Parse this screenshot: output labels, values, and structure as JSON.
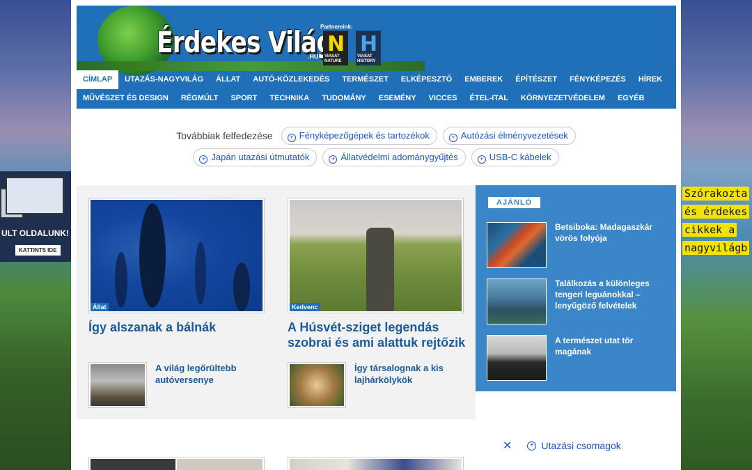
{
  "site": {
    "logo_text": "Érdekes Világ",
    "logo_suffix": ".HU",
    "partners_label": "Partnereink:",
    "partners": [
      {
        "letter": "N",
        "label": "VIASAT NATURE"
      },
      {
        "letter": "H",
        "label": "VIASAT HISTORY"
      }
    ]
  },
  "nav": {
    "row1": [
      "CÍMLAP",
      "UTAZÁS-NAGYVILÁG",
      "ÁLLAT",
      "AUTÓ-KÖZLEKEDÉS",
      "TERMÉSZET",
      "ELKÉPESZTŐ",
      "EMBEREK",
      "ÉPÍTÉSZET",
      "FÉNYKÉPEZÉS",
      "HÍREK"
    ],
    "row2": [
      "MŰVÉSZET ÉS DESIGN",
      "RÉGMÚLT",
      "SPORT",
      "TECHNIKA",
      "TUDOMÁNY",
      "ESEMÉNY",
      "VICCES",
      "ÉTEL-ITAL",
      "KÖRNYEZETVÉDELEM",
      "EGYÉB"
    ],
    "active": "CÍMLAP"
  },
  "explore": {
    "label": "Továbbiak felfedezése",
    "row1": [
      "Fényképezőgépek és tartozékok",
      "Autózási élményvezetések"
    ],
    "row2": [
      "Japán utazási útmutatók",
      "Állatvédelmi adománygyűjtés",
      "USB-C kábelek"
    ]
  },
  "articles": {
    "main": [
      {
        "tag": "Állat",
        "title": "Így alszanak a bálnák"
      },
      {
        "tag": "Kedvenc",
        "title": "A Húsvét-sziget legendás szobrai és ami alattuk rejtőzik"
      }
    ],
    "small": [
      {
        "title": "A világ legőrültebb autóversenye"
      },
      {
        "title": "Így társalognak a kis lajhárkölykök"
      }
    ]
  },
  "sidebar": {
    "heading": "AJÁNLÓ",
    "items": [
      {
        "title": "Betsiboka: Madagaszkár vörös folyója"
      },
      {
        "title": "Találkozás a különleges tengeri leguánokkal – lenyűgöző felvételek"
      },
      {
        "title": "A természet utat tör magának"
      }
    ]
  },
  "left_ad": {
    "text": "ULT OLDALUNK!",
    "button": "KATTINTS IDE"
  },
  "right_ad": {
    "lines": [
      "Szórakozta",
      "és érdekes",
      "cikkek a",
      "nagyvilágb"
    ]
  },
  "bottom": {
    "chip": "Utazási csomagok"
  }
}
